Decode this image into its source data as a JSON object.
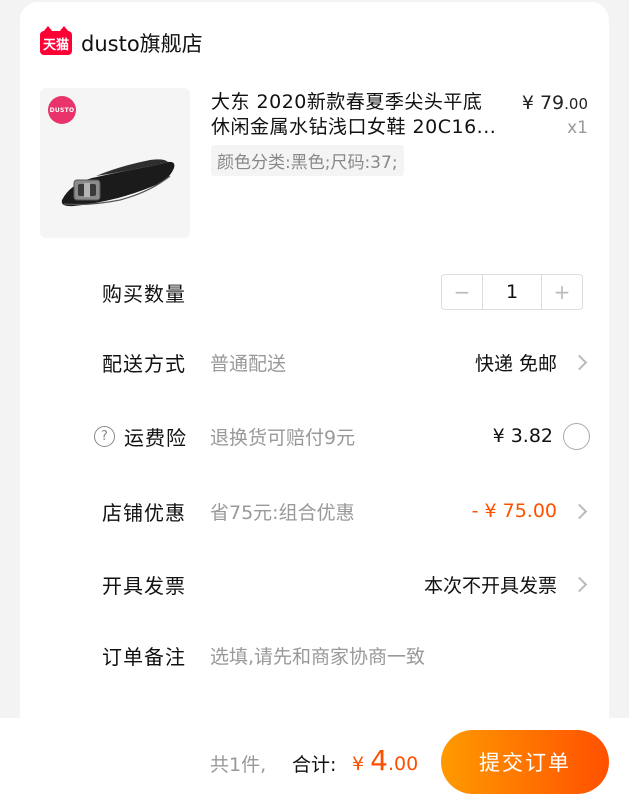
{
  "shop": {
    "logo_text": "天猫",
    "name": "dusto旗舰店"
  },
  "product": {
    "brand_badge": "DUSTO",
    "title_line1": "大东 2020新款春夏季尖头平底",
    "title_line2": "休闲金属水钻浅口女鞋 20C16...",
    "sku": "颜色分类:黑色;尺码:37;",
    "price_symbol": "¥",
    "price_int": "79",
    "price_dec": ".00",
    "quantity": "x1"
  },
  "rows": {
    "quantity": {
      "label": "购买数量",
      "value": "1",
      "minus": "−",
      "plus": "+"
    },
    "delivery": {
      "label": "配送方式",
      "value": "普通配送",
      "right": "快递 免邮"
    },
    "insurance": {
      "label": "运费险",
      "value": "退换货可赔付9元",
      "right": "¥ 3.82",
      "help": "?"
    },
    "coupon": {
      "label": "店铺优惠",
      "value": "省75元:组合优惠",
      "right": "- ¥ 75.00"
    },
    "invoice": {
      "label": "开具发票",
      "right": "本次不开具发票"
    },
    "note": {
      "label": "订单备注",
      "placeholder": "选填,请先和商家协商一致"
    }
  },
  "footer": {
    "count": "共1件,",
    "total_label": "合计:",
    "currency": "¥ ",
    "amount_int": "4",
    "amount_dec": ".00",
    "submit": "提交订单"
  },
  "colors": {
    "accent": "#ff5000",
    "tmall_red": "#ff0036",
    "button_gradient_start": "#ff9a00"
  },
  "icons": [
    "tmall-logo-icon",
    "chevron-right-icon",
    "help-circle-icon",
    "radio-circle-icon",
    "minus-icon",
    "plus-icon"
  ]
}
